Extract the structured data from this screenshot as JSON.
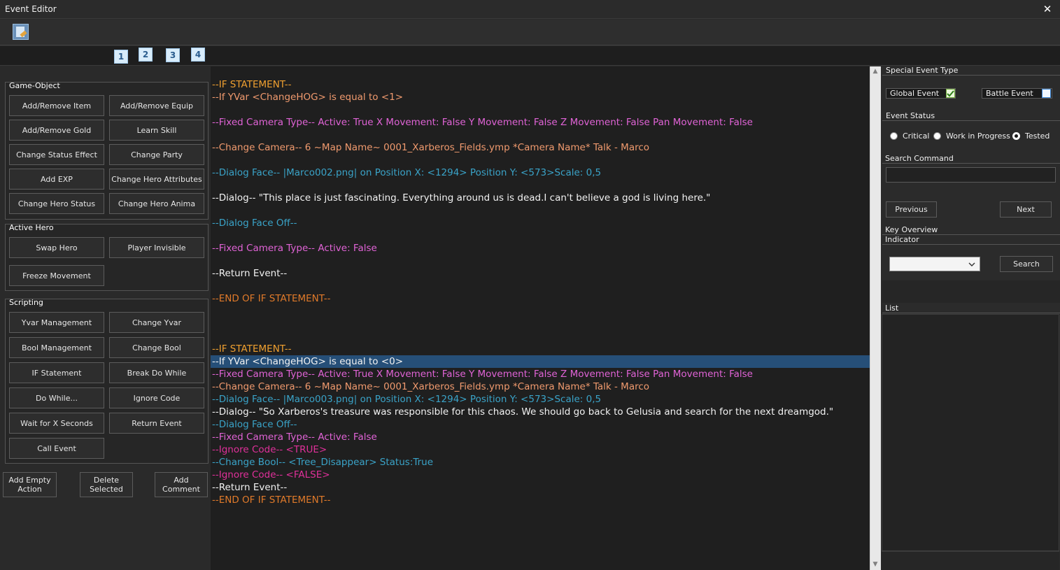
{
  "window": {
    "title": "Event Editor",
    "close_glyph": "✕"
  },
  "toolbar": {
    "icon": "edit-document-icon"
  },
  "page_tabs": [
    "1",
    "2",
    "3",
    "4"
  ],
  "left": {
    "game_object": {
      "title": "Game-Object",
      "buttons": [
        "Add/Remove Item",
        "Add/Remove Equip",
        "Add/Remove Gold",
        "Learn Skill",
        "Change Status Effect",
        "Change Party",
        "Add EXP",
        "Change Hero Attributes",
        "Change Hero Status",
        "Change Hero Anima"
      ]
    },
    "active_hero": {
      "title": "Active Hero",
      "buttons": [
        "Swap Hero",
        "Player Invisible",
        "Freeze Movement"
      ]
    },
    "scripting": {
      "title": "Scripting",
      "buttons": [
        "Yvar Management",
        "Change Yvar",
        "Bool Management",
        "Change Bool",
        "IF Statement",
        "Break Do While",
        "Do While...",
        "Ignore Code",
        "Wait for X Seconds",
        "Return Event",
        "Call Event"
      ]
    },
    "bottom": {
      "add_empty": [
        "Add Empty",
        "Action"
      ],
      "delete": [
        "Delete",
        "Selected"
      ],
      "comment": [
        "Add",
        "Comment"
      ]
    }
  },
  "editor": {
    "lines": [
      "--IF STATEMENT--",
      "--If YVar <ChangeHOG> is equal to <1>",
      "--Fixed Camera Type-- Active: True X Movement: False Y Movement: False Z Movement: False Pan Movement: False",
      "--Change Camera-- 6 ~Map Name~ 0001_Xarberos_Fields.ymp *Camera Name* Talk - Marco",
      "--Dialog Face-- |Marco002.png| on Position X: <1294>  Position Y: <573>Scale: 0,5",
      "--Dialog-- \"This place is just fascinating. Everything around us is dead.I can't believe a god is living here.\"",
      "--Dialog Face Off--",
      "--Fixed Camera Type-- Active: False",
      "--Return Event--",
      "--END OF IF STATEMENT--",
      "--IF STATEMENT--",
      "--If YVar <ChangeHOG> is equal to <0>",
      "--Fixed Camera Type-- Active: True X Movement: False Y Movement: False Z Movement: False Pan Movement: False",
      "--Change Camera-- 6 ~Map Name~ 0001_Xarberos_Fields.ymp *Camera Name* Talk - Marco",
      "--Dialog Face-- |Marco003.png| on Position X: <1294>  Position Y: <573>Scale: 0,5",
      "--Dialog-- \"So Xarberos's treasure was responsible for this chaos. We should go back to Gelusia and search for the next dreamgod.\"",
      "--Dialog Face Off--",
      "--Fixed Camera Type-- Active: False",
      "--Ignore Code-- <TRUE>",
      "--Change Bool-- <Tree_Disappear> Status:True",
      "--Ignore Code-- <FALSE>",
      "--Return Event--",
      "--END OF IF STATEMENT--"
    ],
    "selected_line": "--If YVar <ChangeHOG> is equal to <0>"
  },
  "right": {
    "special_event_type": "Special Event Type",
    "global_event": "Global Event",
    "battle_event": "Battle Event",
    "event_status": "Event Status",
    "status_options": [
      "Critical",
      "Work in Progress",
      "Tested"
    ],
    "status_selected": "Tested",
    "search_command": "Search Command",
    "search_value": "",
    "previous": "Previous",
    "next": "Next",
    "key_overview": "Key Overview",
    "indicator": "Indicator",
    "indicator_value": "",
    "search": "Search",
    "list": "List"
  },
  "colors": {
    "selection": "#264f78",
    "if": "#f0a030",
    "camera": "#e063d6",
    "dialog_face": "#3aa3c8"
  }
}
